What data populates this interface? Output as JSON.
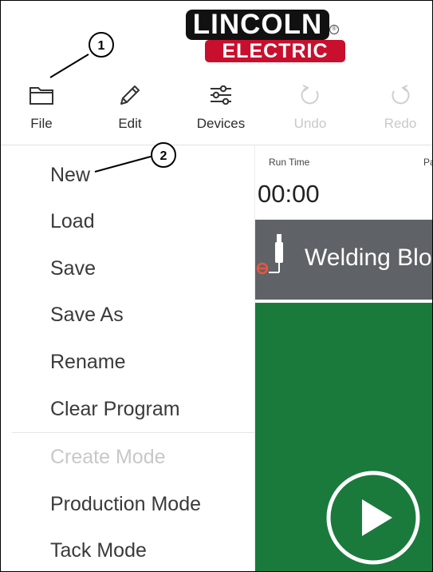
{
  "logo": {
    "line1": "LINCOLN",
    "line2": "ELECTRIC",
    "reg": "®"
  },
  "toolbar": [
    {
      "label": "File",
      "icon": "folder-icon",
      "enabled": true
    },
    {
      "label": "Edit",
      "icon": "pencil-icon",
      "enabled": true
    },
    {
      "label": "Devices",
      "icon": "sliders-icon",
      "enabled": true
    },
    {
      "label": "Undo",
      "icon": "undo-icon",
      "enabled": false
    },
    {
      "label": "Redo",
      "icon": "redo-icon",
      "enabled": false
    }
  ],
  "callouts": [
    "1",
    "2"
  ],
  "file_menu": [
    {
      "label": "New",
      "enabled": true
    },
    {
      "label": "Load",
      "enabled": true
    },
    {
      "label": "Save",
      "enabled": true
    },
    {
      "label": "Save As",
      "enabled": true
    },
    {
      "label": "Rename",
      "enabled": true
    },
    {
      "label": "Clear Program",
      "enabled": true
    },
    {
      "label": "Create Mode",
      "enabled": false
    },
    {
      "label": "Production Mode",
      "enabled": true
    },
    {
      "label": "Tack Mode",
      "enabled": true
    }
  ],
  "status": {
    "run_time_label": "Run Time",
    "run_time_value": "00:00",
    "next_label_partial": "Pa"
  },
  "block": {
    "title": "Welding Blo"
  },
  "colors": {
    "brand_red": "#c8102e",
    "panel_green": "#1a7a3c",
    "block_gray": "#5f6368",
    "disabled_text": "#c8c8c8"
  }
}
